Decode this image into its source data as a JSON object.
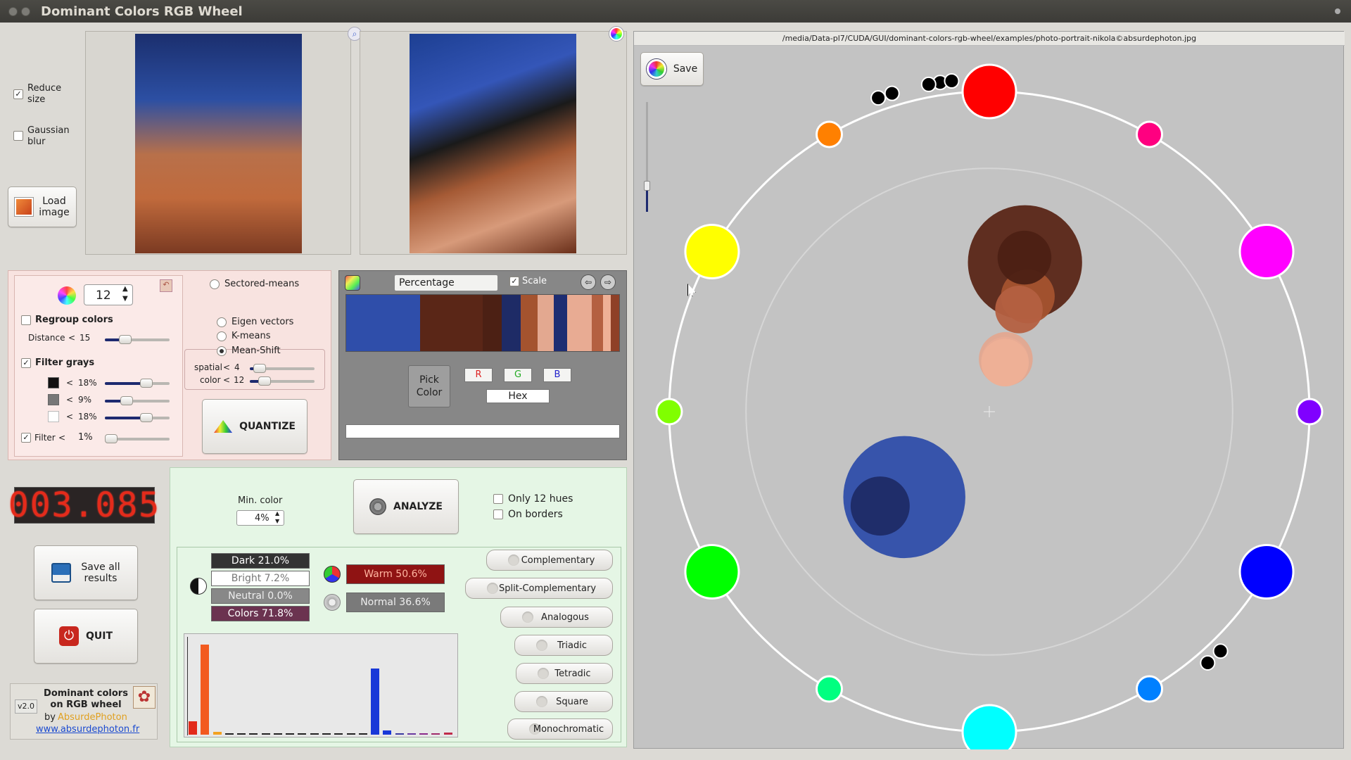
{
  "window": {
    "title": "Dominant Colors RGB Wheel"
  },
  "options": {
    "reduce_size_label": "Reduce\nsize",
    "reduce_size_checked": true,
    "gaussian_label": "Gaussian\nblur",
    "gaussian_checked": false
  },
  "load_button": {
    "label": "Load\nimage"
  },
  "file_path": "/media/Data-pl7/CUDA/GUI/dominant-colors-rgb-wheel/examples/photo-portrait-nikola©absurdephoton.jpg",
  "quantize": {
    "num_colors": "12",
    "regroup_label": "Regroup colors",
    "distance_label": "Distance",
    "distance_op": "<",
    "distance_value": "15",
    "filter_grays_label": "Filter grays",
    "gray_rows": [
      {
        "swatch": "#111111",
        "op": "<",
        "value": "18%"
      },
      {
        "swatch": "#777777",
        "op": "<",
        "value": "9%"
      },
      {
        "swatch": "#ffffff",
        "op": "<",
        "value": "18%"
      }
    ],
    "filter_label": "Filter",
    "filter_op": "<",
    "filter_value": "1%",
    "methods": [
      {
        "label": "Sectored-means",
        "selected": false
      },
      {
        "label": "Eigen vectors",
        "selected": false
      },
      {
        "label": "K-means",
        "selected": false
      },
      {
        "label": "Mean-Shift",
        "selected": true
      }
    ],
    "spatial_label": "spatial",
    "spatial_op": "<",
    "spatial_value": "4",
    "color_label": "color",
    "color_op": "<",
    "color_value": "12",
    "quantize_button": "QUANTIZE"
  },
  "palette": {
    "mode": "Percentage",
    "scale_label": "Scale",
    "scale_checked": true,
    "swatches": [
      {
        "color": "#2f4eaa",
        "weight": 27
      },
      {
        "color": "#5a2617",
        "weight": 23
      },
      {
        "color": "#4c2014",
        "weight": 7
      },
      {
        "color": "#1e2b66",
        "weight": 7
      },
      {
        "color": "#a4532f",
        "weight": 6
      },
      {
        "color": "#e3a890",
        "weight": 6
      },
      {
        "color": "#1d2d72",
        "weight": 5
      },
      {
        "color": "#e8ab93",
        "weight": 9
      },
      {
        "color": "#b46041",
        "weight": 4
      },
      {
        "color": "#eeb096",
        "weight": 3
      },
      {
        "color": "#8f4027",
        "weight": 3
      }
    ],
    "pick_color_label": "Pick\nColor",
    "r_label": "R",
    "g_label": "G",
    "b_label": "B",
    "hex_label": "Hex"
  },
  "timer": {
    "value": "003.085"
  },
  "save_all": {
    "label": "Save all\nresults"
  },
  "quit": {
    "label": "QUIT"
  },
  "about": {
    "version": "v2.0",
    "title": "Dominant colors\non RGB wheel",
    "by": "by",
    "author": "AbsurdePhoton",
    "url": "www.absurdephoton.fr"
  },
  "analyze": {
    "min_color_label": "Min. color",
    "min_color_value": "4%",
    "analyze_button": "ANALYZE",
    "only12_label": "Only 12 hues",
    "on_borders_label": "On borders",
    "stats": [
      {
        "label": "Dark 21.0%",
        "bg": "#333333",
        "fg": "#ffffff"
      },
      {
        "label": "Bright 7.2%",
        "bg": "#ffffff",
        "fg": "#777777"
      },
      {
        "label": "Neutral 0.0%",
        "bg": "#888888",
        "fg": "#eeeeee"
      },
      {
        "label": "Colors 71.8%",
        "bg": "#6b3350",
        "fg": "#ffffff"
      }
    ],
    "warm": {
      "label": "Warm 50.6%",
      "bg": "#8f1313",
      "fg": "#ffb5a0"
    },
    "normal": {
      "label": "Normal 36.6%",
      "bg": "#7a7a7a",
      "fg": "#eeeeee"
    },
    "harmony_buttons": [
      "Complementary",
      "Split-Complementary",
      "Analogous",
      "Triadic",
      "Tetradic",
      "Square",
      "Monochromatic"
    ]
  },
  "histogram": {
    "bars": [
      {
        "color": "#e22a1a",
        "value": 0.14
      },
      {
        "color": "#f25a1f",
        "value": 0.93
      },
      {
        "color": "#f2a221",
        "value": 0.03
      },
      {
        "color": "#222222",
        "value": 0.01
      },
      {
        "color": "#222222",
        "value": 0.01
      },
      {
        "color": "#222222",
        "value": 0.01
      },
      {
        "color": "#222222",
        "value": 0.01
      },
      {
        "color": "#222222",
        "value": 0.01
      },
      {
        "color": "#222222",
        "value": 0.01
      },
      {
        "color": "#222222",
        "value": 0.01
      },
      {
        "color": "#222222",
        "value": 0.01
      },
      {
        "color": "#222222",
        "value": 0.01
      },
      {
        "color": "#222222",
        "value": 0.01
      },
      {
        "color": "#222222",
        "value": 0.01
      },
      {
        "color": "#222222",
        "value": 0.01
      },
      {
        "color": "#1838d8",
        "value": 0.68
      },
      {
        "color": "#1838d8",
        "value": 0.04
      },
      {
        "color": "#3a3aa0",
        "value": 0.01
      },
      {
        "color": "#6a3aa0",
        "value": 0.01
      },
      {
        "color": "#8a2a8a",
        "value": 0.01
      },
      {
        "color": "#a02a6a",
        "value": 0.01
      },
      {
        "color": "#c02a4a",
        "value": 0.02
      }
    ]
  },
  "wheel": {
    "save_label": "Save",
    "hues": [
      {
        "name": "red",
        "color": "#ff0000",
        "big": true
      },
      {
        "name": "rose",
        "color": "#ff0080",
        "big": false
      },
      {
        "name": "magenta",
        "color": "#ff00ff",
        "big": true
      },
      {
        "name": "violet",
        "color": "#8000ff",
        "big": false
      },
      {
        "name": "blue",
        "color": "#0000ff",
        "big": true
      },
      {
        "name": "azure",
        "color": "#0080ff",
        "big": false
      },
      {
        "name": "cyan",
        "color": "#00ffff",
        "big": true
      },
      {
        "name": "spring-green",
        "color": "#00ff80",
        "big": false
      },
      {
        "name": "green",
        "color": "#00ff00",
        "big": true
      },
      {
        "name": "chartreuse",
        "color": "#80ff00",
        "big": false
      },
      {
        "name": "yellow",
        "color": "#ffff00",
        "big": true
      },
      {
        "name": "orange",
        "color": "#ff8000",
        "big": false
      }
    ],
    "dominant": [
      {
        "color": "#5a2617",
        "weight": 23
      },
      {
        "color": "#2f4eaa",
        "weight": 27
      },
      {
        "color": "#1e2b66",
        "weight": 4
      },
      {
        "color": "#a4532f",
        "weight": 3
      },
      {
        "color": "#b46041",
        "weight": 2
      },
      {
        "color": "#e3a890",
        "weight": 3
      },
      {
        "color": "#e8ab93",
        "weight": 2
      },
      {
        "color": "#eeb096",
        "weight": 2
      },
      {
        "color": "#4c2014",
        "weight": 3
      }
    ]
  }
}
